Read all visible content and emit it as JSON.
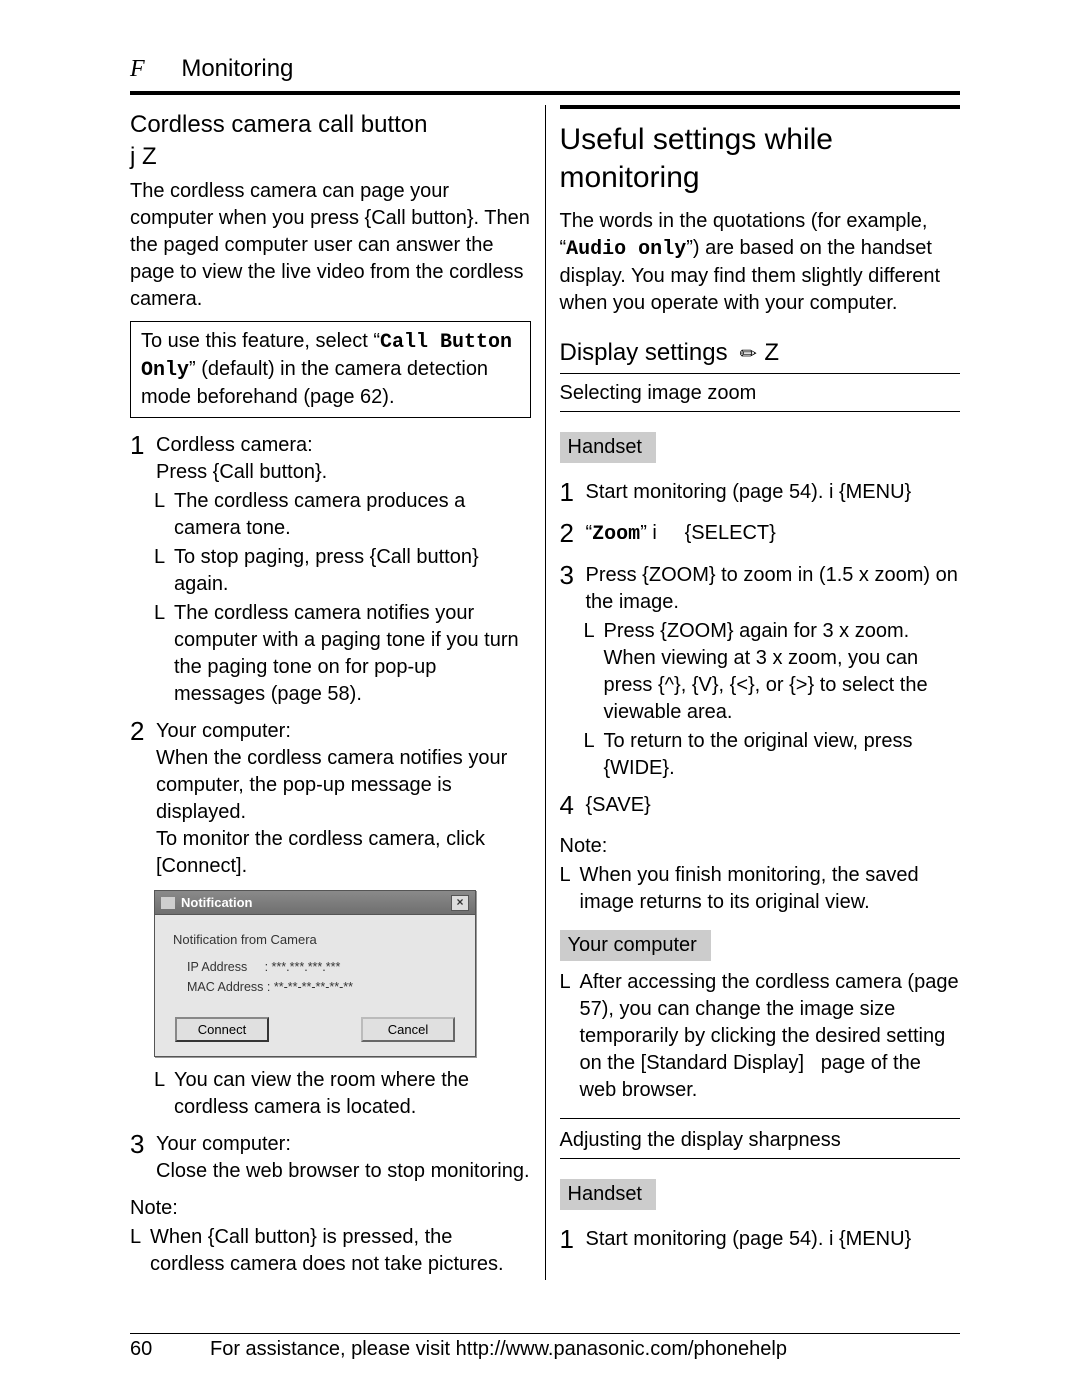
{
  "header": {
    "section_letter": "F",
    "section_title": "Monitoring"
  },
  "left": {
    "h2": "Cordless camera call button",
    "h2_sub": "j Z",
    "intro": "The cordless camera can page your computer when you press {Call button}. Then the paged computer user can answer the page to view the live video from the cordless camera.",
    "box_pre": "To use this feature, select “",
    "box_mono": "Call Button Only",
    "box_post": "” (default) in the camera detection mode beforehand (page 62).",
    "step1_a": "Cordless camera:",
    "step1_b": "Press {Call button}.",
    "step1_bul1": "The cordless camera produces a camera tone.",
    "step1_bul2": "To stop paging, press {Call button} again.",
    "step1_bul3": "The cordless camera notifies your computer with a paging tone if you turn the paging tone on for pop-up messages (page 58).",
    "step2_a": "Your computer:",
    "step2_b": "When the cordless camera notifies your computer, the pop-up message is displayed.",
    "step2_c": "To monitor the cordless camera, click [Connect].",
    "dialog": {
      "title": "Notification",
      "subtitle": "Notification from Camera",
      "ip_label": "IP Address",
      "ip_value": ": ***.***.***.***",
      "mac_label": "MAC Address",
      "mac_value": ": **-**-**-**-**-**",
      "connect": "Connect",
      "cancel": "Cancel"
    },
    "step2_bul1": "You can view the room where the cordless camera is located.",
    "step3_a": "Your computer:",
    "step3_b": "Close the web browser to stop monitoring.",
    "note_label": "Note:",
    "note1": "When {Call button} is pressed, the cordless camera does not take pictures."
  },
  "right": {
    "h1": "Useful settings while monitoring",
    "intro_pre": "The words in the quotations (for example, “",
    "intro_mono": "Audio only",
    "intro_post": "”) are based on the handset display. You may find them slightly different when you operate with your computer.",
    "h3": "Display settings",
    "h3_suffix": "Z",
    "sub1": "Selecting image zoom",
    "label_handset": "Handset",
    "s1": "Start monitoring (page 54). i {MENU}",
    "s2_pre": "“",
    "s2_mono": "Zoom",
    "s2_post": "” i     {SELECT}",
    "s3": "Press {ZOOM} to zoom in (1.5 x zoom) on the image.",
    "s3_bul1": "Press {ZOOM} again for 3 x zoom. When viewing at 3 x zoom, you can press {^}, {V}, {<}, or {>} to select the viewable area.",
    "s3_bul2": "To return to the original view, press {WIDE}.",
    "s4": "{SAVE}",
    "note_label": "Note:",
    "note1": "When you finish monitoring, the saved image returns to its original view.",
    "label_computer": "Your computer",
    "comp1": "After accessing the cordless camera (page 57), you can change the image size temporarily by clicking the desired setting on the [Standard Display]   page of the web browser.",
    "sub2": "Adjusting the display sharpness",
    "s1b": "Start monitoring (page 54). i {MENU}"
  },
  "footer": {
    "page": "60",
    "text": "For assistance, please visit http://www.panasonic.com/phonehelp"
  }
}
